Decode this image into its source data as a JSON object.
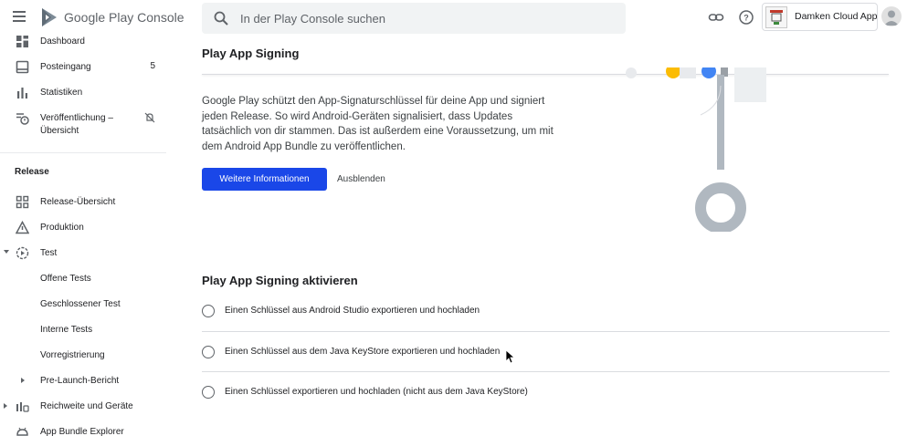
{
  "header": {
    "brand": "Google Play Console",
    "search_placeholder": "In der Play Console suchen",
    "app_name": "Damken Cloud App"
  },
  "sidebar": {
    "items": [
      {
        "label": "Dashboard",
        "icon": "dashboard-icon"
      },
      {
        "label": "Posteingang",
        "icon": "inbox-icon",
        "badge": "5"
      },
      {
        "label": "Statistiken",
        "icon": "bar-chart-icon"
      },
      {
        "label": "Veröffentlichung – Übersicht",
        "icon": "publishing-history-icon"
      }
    ],
    "section_title": "Release",
    "release_items": [
      {
        "label": "Release-Übersicht",
        "icon": "grid-icon"
      },
      {
        "label": "Produktion",
        "icon": "warning-icon"
      },
      {
        "label": "Test",
        "icon": "play-circle-icon"
      },
      {
        "label": "Offene Tests"
      },
      {
        "label": "Geschlossener Test"
      },
      {
        "label": "Interne Tests"
      },
      {
        "label": "Vorregistrierung"
      },
      {
        "label": "Pre-Launch-Bericht"
      },
      {
        "label": "Reichweite und Geräte",
        "icon": "reach-icon"
      },
      {
        "label": "App Bundle Explorer",
        "icon": "android-icon"
      }
    ]
  },
  "main": {
    "card": {
      "title": "Play App Signing",
      "description": "Google Play schützt den App-Signaturschlüssel für deine App und signiert jeden Release. So wird Android-Geräten signalisiert, dass Updates tatsächlich von dir stammen. Das ist außerdem eine Voraussetzung, um mit dem Android App Bundle zu veröffentlichen.",
      "primary_button": "Weitere Informationen",
      "secondary_button": "Ausblenden"
    },
    "activate": {
      "title": "Play App Signing aktivieren",
      "options": [
        "Einen Schlüssel aus Android Studio exportieren und hochladen",
        "Einen Schlüssel aus dem Java KeyStore exportieren und hochladen",
        "Einen Schlüssel exportieren und hochladen (nicht aus dem Java KeyStore)"
      ]
    }
  },
  "colors": {
    "primary": "#1a47e8",
    "illustration_gray": "#b0b8c0"
  }
}
